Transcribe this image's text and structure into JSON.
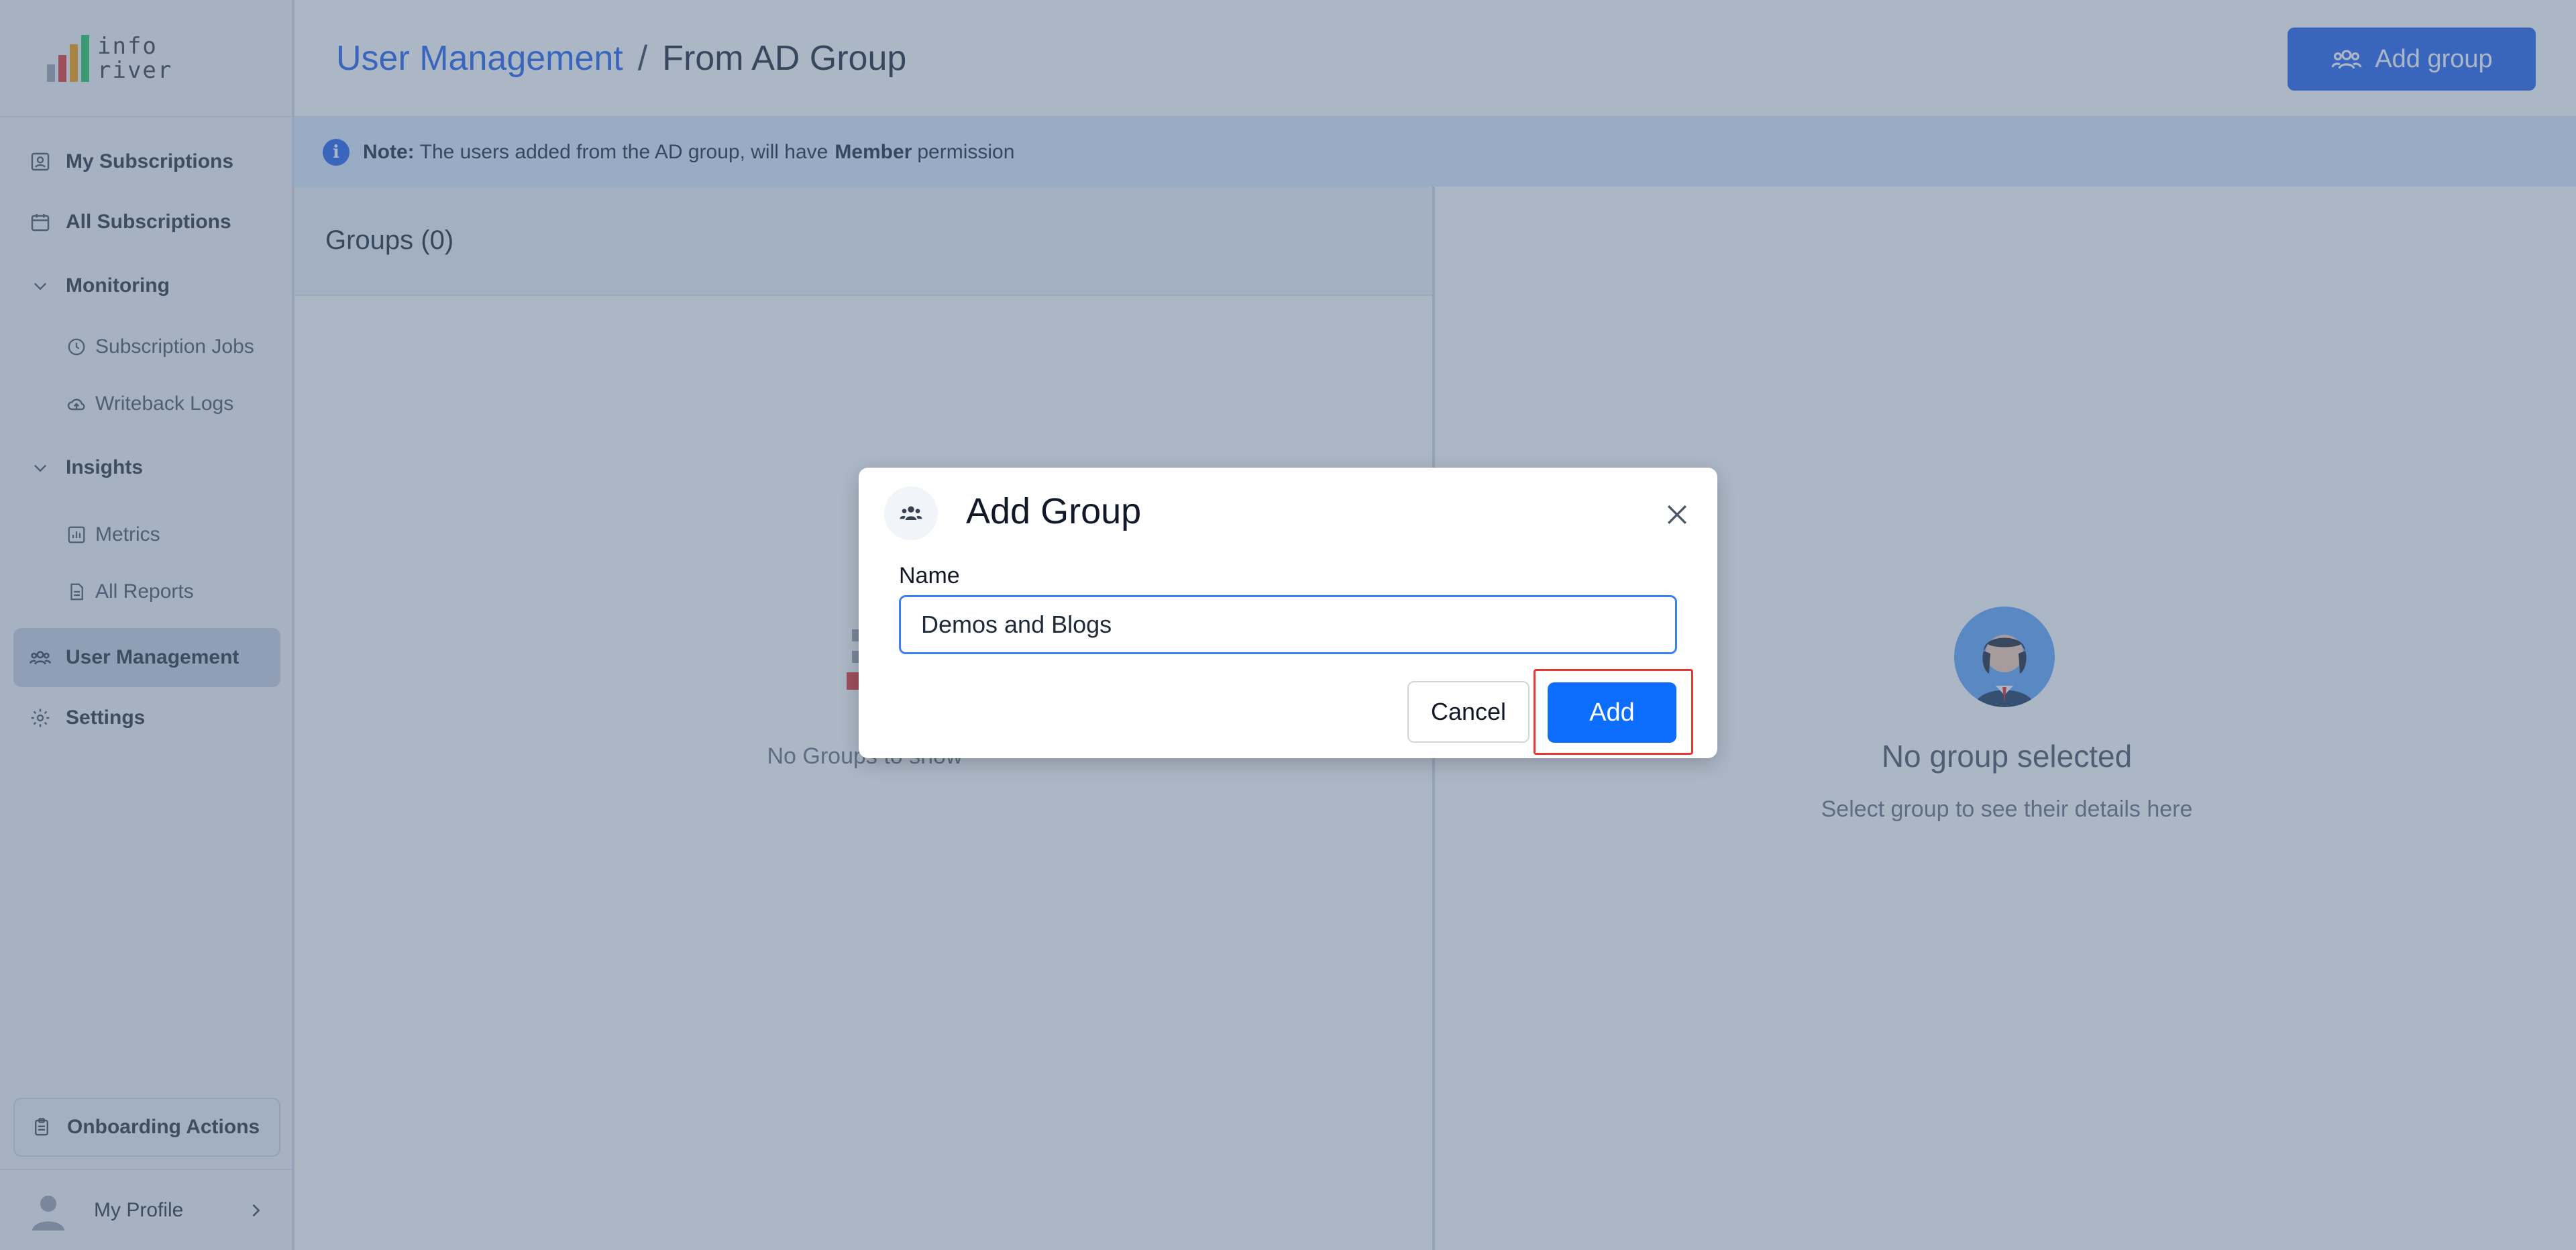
{
  "logo": {
    "line1": "info",
    "line2": "river",
    "bar_colors": [
      "#9ca3af",
      "#e53935",
      "#f59e0b",
      "#22c55e"
    ]
  },
  "sidebar": {
    "items": [
      {
        "label": "My Subscriptions",
        "icon": "subscription-user-icon"
      },
      {
        "label": "All Subscriptions",
        "icon": "calendar-icon"
      },
      {
        "label": "Monitoring",
        "icon": "chevron-down-icon"
      },
      {
        "label": "Subscription Jobs",
        "icon": "clock-icon"
      },
      {
        "label": "Writeback Logs",
        "icon": "cloud-upload-icon"
      },
      {
        "label": "Insights",
        "icon": "chevron-down-icon"
      },
      {
        "label": "Metrics",
        "icon": "bar-chart-icon"
      },
      {
        "label": "All Reports",
        "icon": "document-icon"
      },
      {
        "label": "User Management",
        "icon": "users-icon"
      },
      {
        "label": "Settings",
        "icon": "gear-icon"
      }
    ],
    "onboarding": "Onboarding Actions",
    "profile": "My Profile"
  },
  "header": {
    "breadcrumb_link": "User Management",
    "breadcrumb_separator": "/",
    "breadcrumb_current": "From AD Group",
    "add_group_label": "Add group"
  },
  "note": {
    "prefix": "Note:",
    "text": "The users added from the AD group, will have",
    "permission": "Member",
    "suffix": "permission"
  },
  "groups": {
    "header": "Groups (0)",
    "empty_text": "No Groups to show"
  },
  "details": {
    "title": "No group selected",
    "subtitle": "Select group to see their details here"
  },
  "modal": {
    "title": "Add Group",
    "name_label": "Name",
    "name_value": "Demos and Blogs",
    "cancel_label": "Cancel",
    "add_label": "Add"
  },
  "colors": {
    "accent": "#2563eb",
    "primary_button": "#0d6efd",
    "highlight": "#e53935",
    "active_nav": "#c9d2de"
  }
}
